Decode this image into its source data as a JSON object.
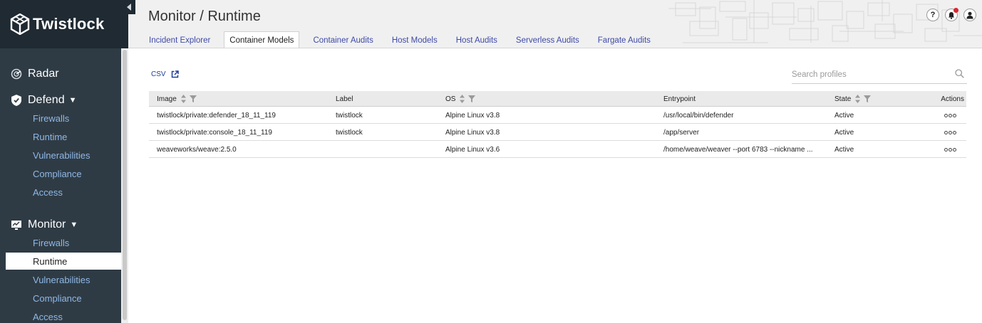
{
  "brand": {
    "name": "Twistlock"
  },
  "sidebar": {
    "sections": [
      {
        "label": "Radar",
        "icon": "radar-icon",
        "items": []
      },
      {
        "label": "Defend",
        "icon": "shield-icon",
        "items": [
          "Firewalls",
          "Runtime",
          "Vulnerabilities",
          "Compliance",
          "Access"
        ]
      },
      {
        "label": "Monitor",
        "icon": "monitor-icon",
        "items": [
          "Firewalls",
          "Runtime",
          "Vulnerabilities",
          "Compliance",
          "Access"
        ],
        "active_item": "Runtime"
      }
    ]
  },
  "header": {
    "title": "Monitor / Runtime",
    "tabs": [
      "Incident Explorer",
      "Container Models",
      "Container Audits",
      "Host Models",
      "Host Audits",
      "Serverless Audits",
      "Fargate Audits"
    ],
    "active_tab": "Container Models",
    "icons": [
      "help-icon",
      "notifications-icon",
      "user-icon"
    ]
  },
  "toolbar": {
    "csv_label": "CSV",
    "search_placeholder": "Search profiles"
  },
  "table": {
    "columns": [
      "Image",
      "Label",
      "OS",
      "Entrypoint",
      "State",
      "Actions"
    ],
    "rows": [
      {
        "image": "twistlock/private:defender_18_11_119",
        "label": "twistlock",
        "os": "Alpine Linux v3.8",
        "entrypoint": "/usr/local/bin/defender",
        "state": "Active"
      },
      {
        "image": "twistlock/private:console_18_11_119",
        "label": "twistlock",
        "os": "Alpine Linux v3.8",
        "entrypoint": "/app/server",
        "state": "Active"
      },
      {
        "image": "weaveworks/weave:2.5.0",
        "label": "",
        "os": "Alpine Linux v3.6",
        "entrypoint": "/home/weave/weaver --port 6783 --nickname ...",
        "state": "Active"
      }
    ]
  },
  "colors": {
    "sidebar_bg": "#2f3b44",
    "sidebar_link": "#8fb8e8",
    "tab_link": "#3e4aa7",
    "notification_dot": "#d9262f"
  }
}
